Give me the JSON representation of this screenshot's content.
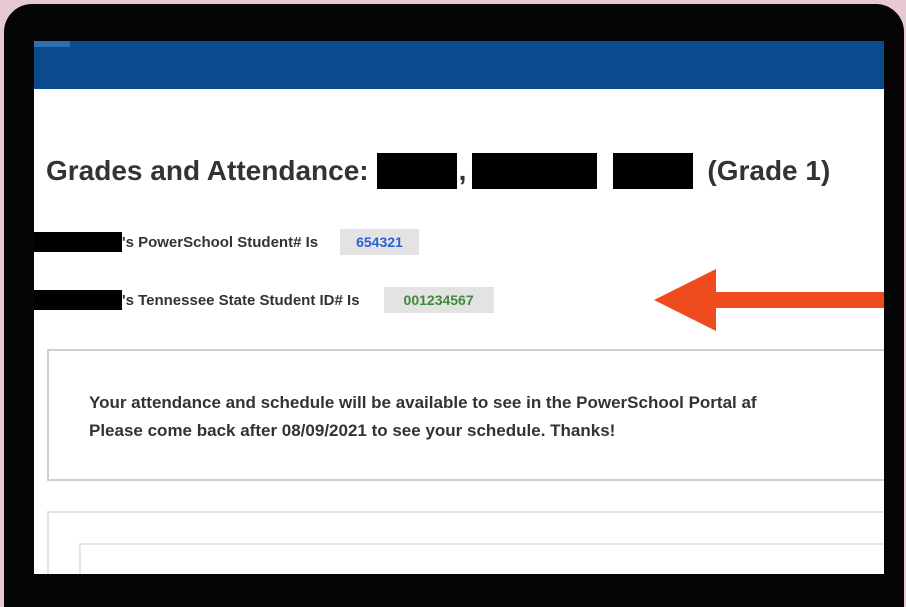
{
  "page": {
    "title_prefix": "Grades and Attendance:",
    "title_separator": ",",
    "title_grade": "(Grade 1)"
  },
  "student_ids": {
    "powerschool_label": "'s PowerSchool Student# Is",
    "powerschool_value": "654321",
    "state_label": "'s Tennessee State Student ID# Is",
    "state_value": "001234567"
  },
  "notice": {
    "line1": "Your attendance and schedule will be available to see in the PowerSchool Portal af",
    "line2": "Please come back after 08/09/2021 to see your schedule. Thanks!"
  },
  "colors": {
    "header_bar": "#0b4a8c",
    "powerschool_id_text": "#2a5fd6",
    "state_id_text": "#3f8a3a",
    "arrow": "#ee4b1e"
  }
}
